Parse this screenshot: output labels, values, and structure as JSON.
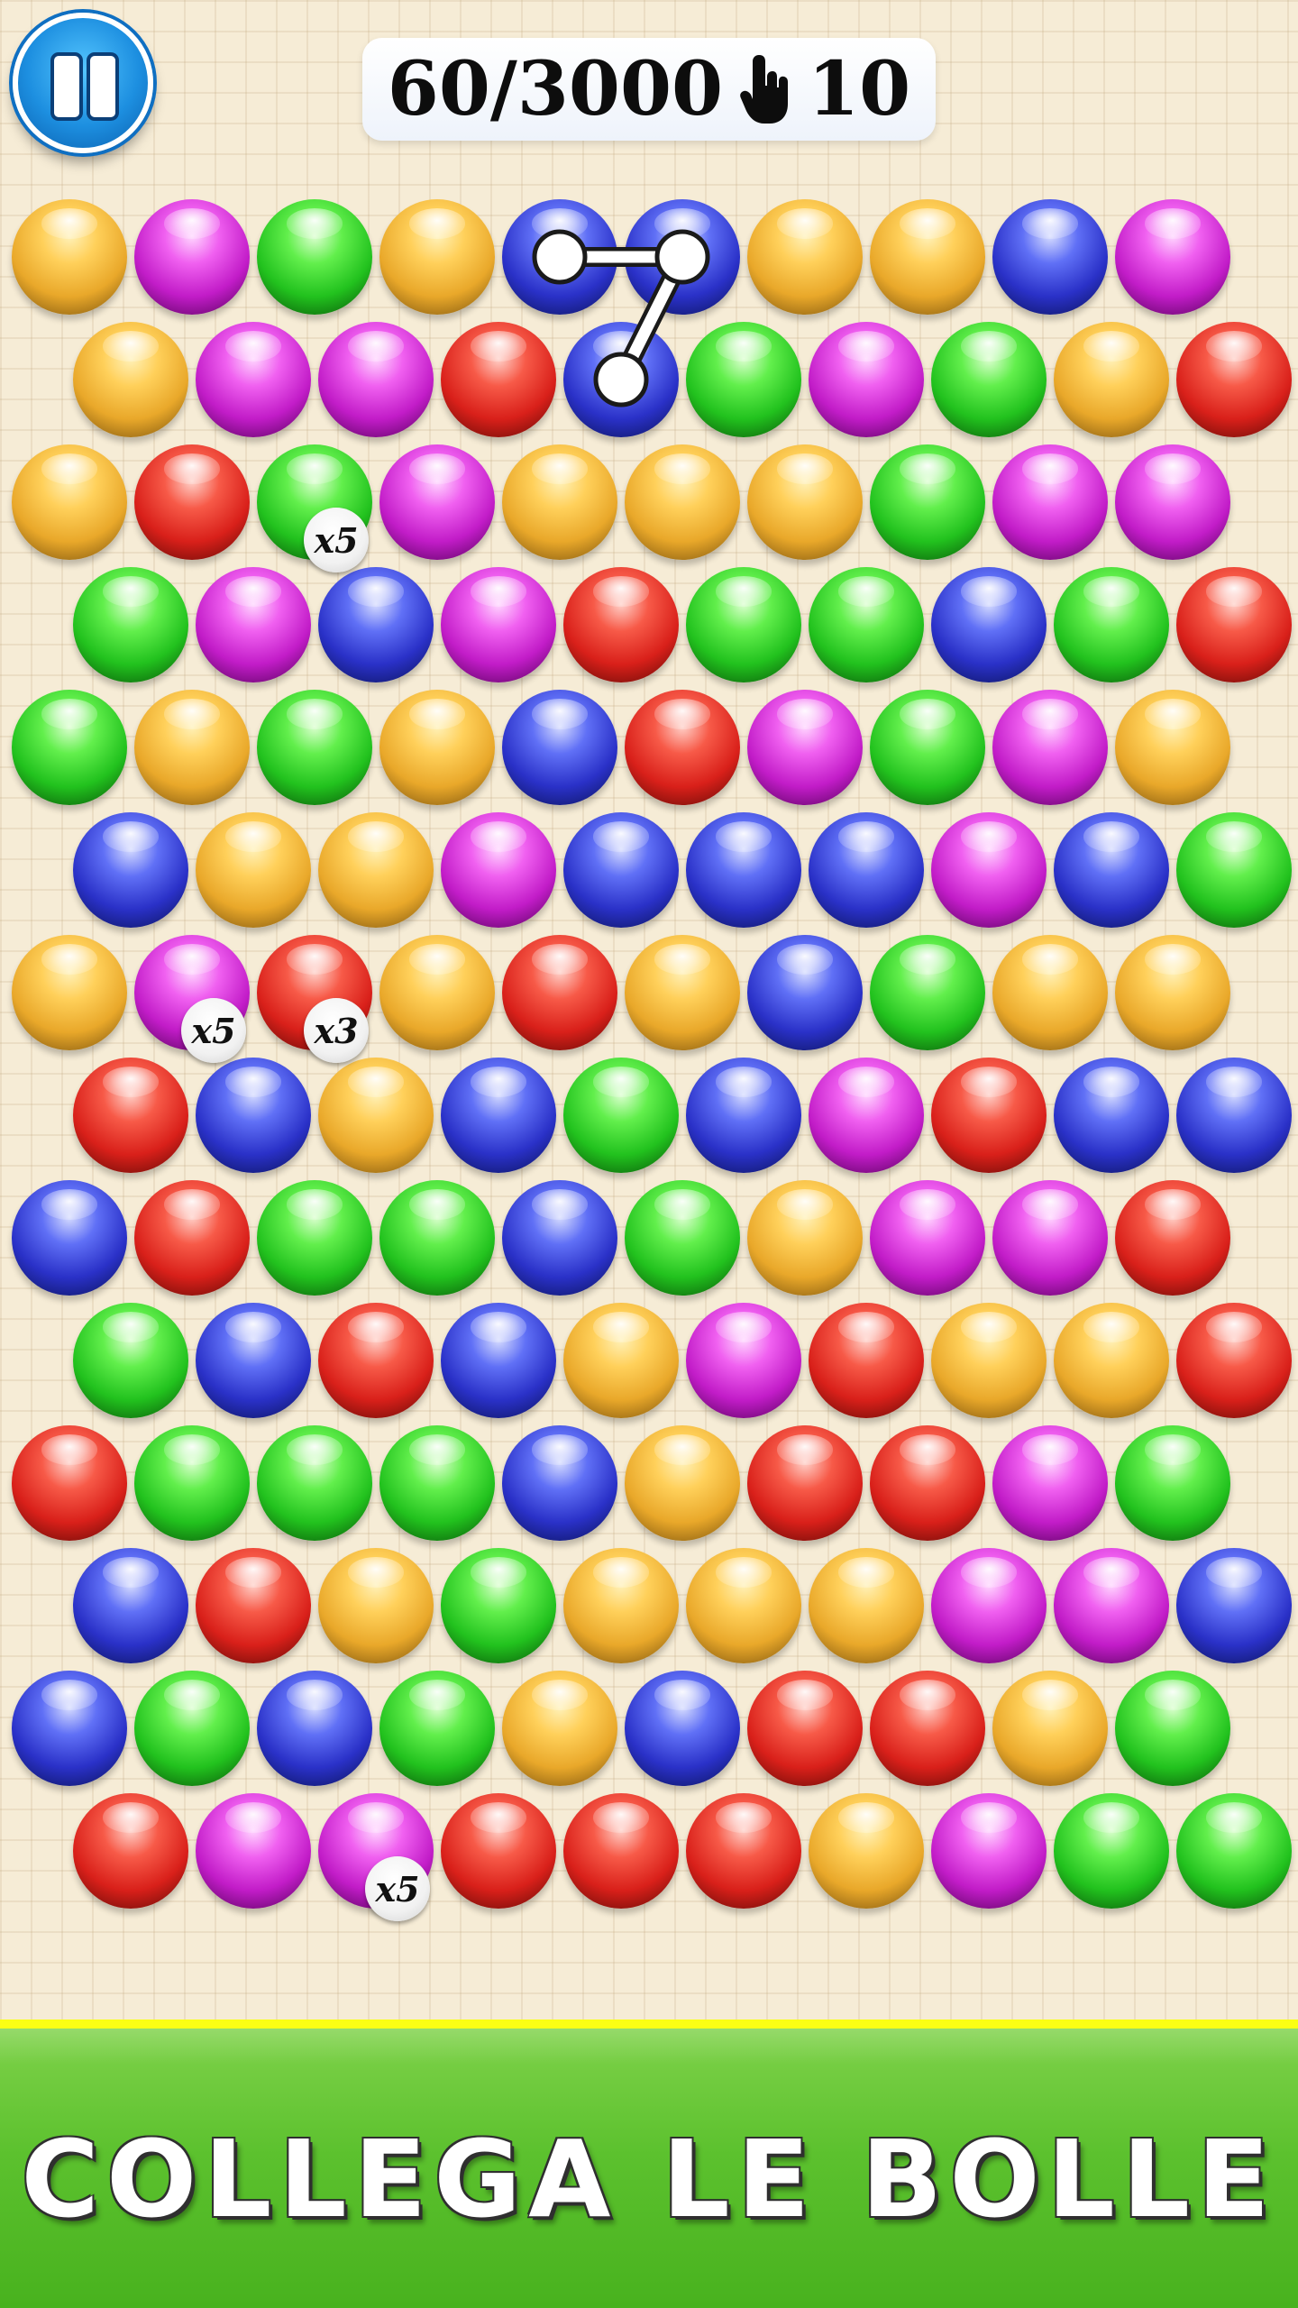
{
  "hud": {
    "score": "60/3000",
    "moves": "10",
    "moves_icon": "hand-pointer-icon",
    "pause_icon": "pause-icon"
  },
  "colors": {
    "O": "#e9a82a",
    "M": "#c21cc8",
    "G": "#22c21e",
    "B": "#2a31c8",
    "R": "#d9201a"
  },
  "board": {
    "rows": [
      "OMGOBBOOBM",
      "OMMRBGMGOR",
      "ORGMOOOGMM",
      "GMBMRGGBGR",
      "GOGOBRMGMO",
      "BOOMBBBMBG",
      "OMROROBGOO",
      "RBOBGBMRBB",
      "BRGGBGOMMR",
      "GBRBOMROOR",
      "RGGGBORRMG",
      "BROGOOOMMB",
      "BGBGOBRROG",
      "RMMRRROMGG"
    ],
    "multipliers": [
      {
        "row": 2,
        "col": 2,
        "label": "x5"
      },
      {
        "row": 6,
        "col": 1,
        "label": "x5"
      },
      {
        "row": 6,
        "col": 2,
        "label": "x3"
      },
      {
        "row": 13,
        "col": 2,
        "label": "x5"
      }
    ],
    "connected_path": [
      {
        "row": 0,
        "col": 4
      },
      {
        "row": 0,
        "col": 5
      },
      {
        "row": 1,
        "col": 4
      }
    ]
  },
  "footer": {
    "title": "COLLEGA LE BOLLE"
  }
}
